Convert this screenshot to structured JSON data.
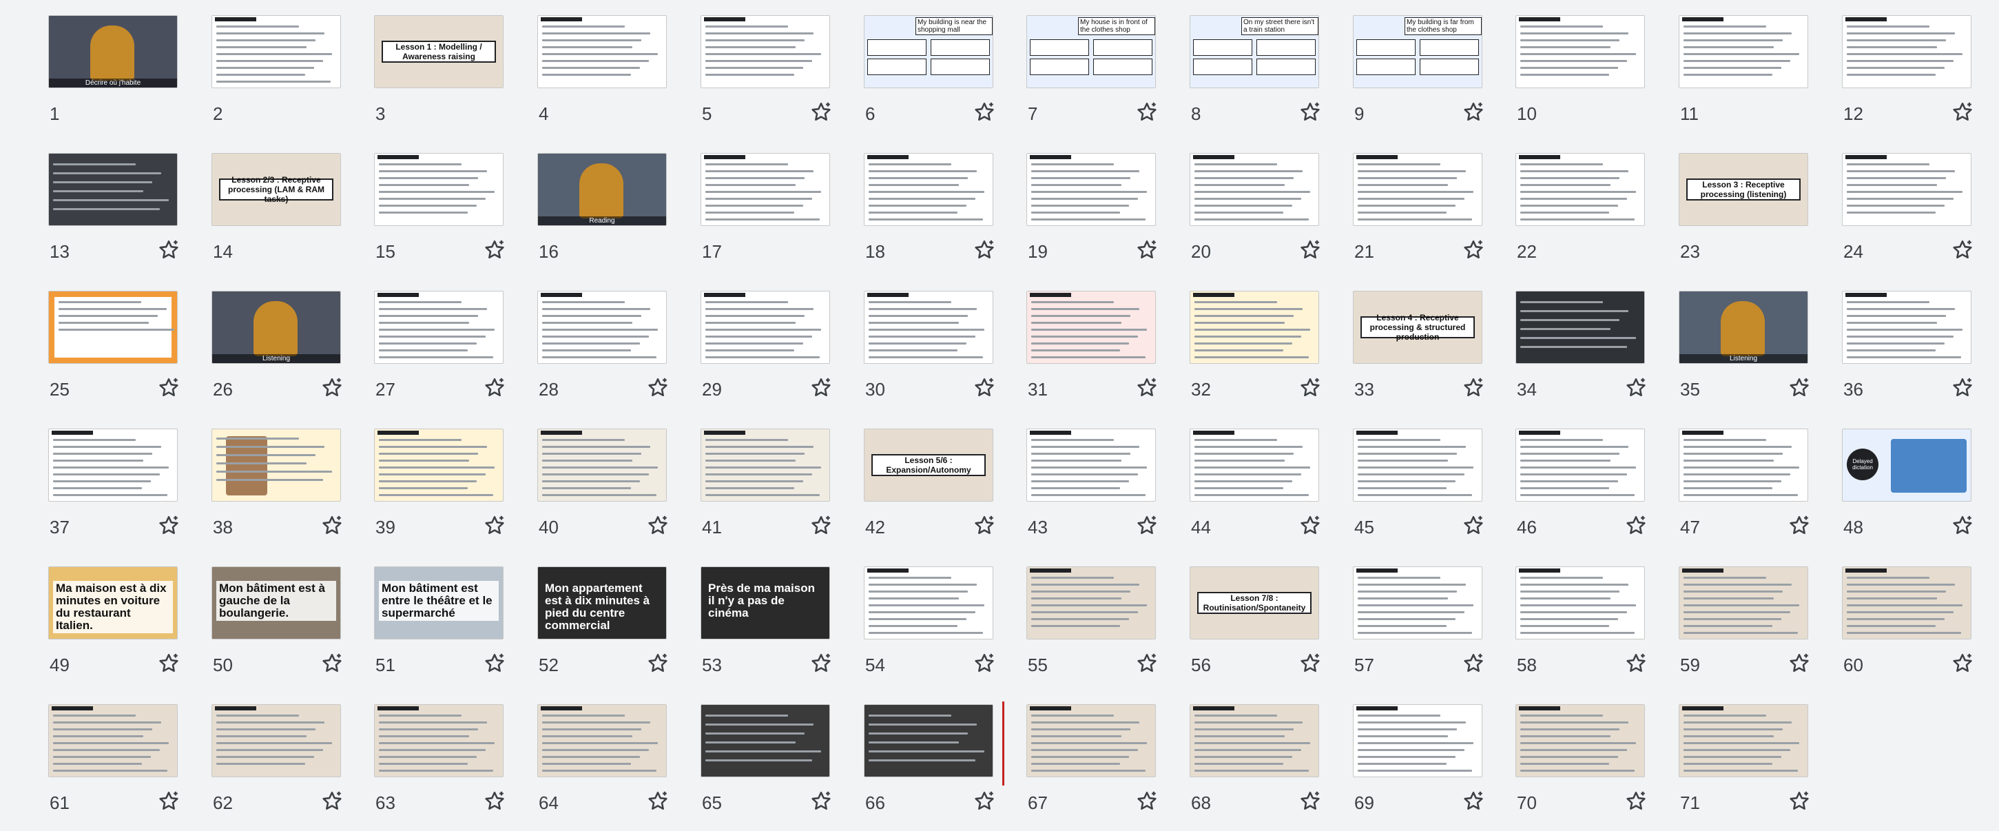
{
  "slides": [
    {
      "n": "1",
      "kind": "photo",
      "caption": "Décrire où j'habite",
      "bg": "#4a4f5e"
    },
    {
      "n": "2",
      "kind": "table",
      "bg": "#ffffff"
    },
    {
      "n": "3",
      "kind": "lesson",
      "text": "Lesson 1 : Modelling / Awareness raising",
      "bg": "#e6ddd0"
    },
    {
      "n": "4",
      "kind": "list",
      "bg": "#ffffff"
    },
    {
      "n": "5",
      "kind": "list",
      "bg": "#ffffff"
    },
    {
      "n": "6",
      "kind": "boxes",
      "text": "My building is near the shopping mall",
      "bg": "#e8f0fe"
    },
    {
      "n": "7",
      "kind": "boxes",
      "text": "My house is in front of the clothes shop",
      "bg": "#e8f0fe"
    },
    {
      "n": "8",
      "kind": "boxes",
      "text": "On my street there isn't a train station",
      "bg": "#e8f0fe"
    },
    {
      "n": "9",
      "kind": "boxes",
      "text": "My building is far from the clothes shop",
      "bg": "#e8f0fe"
    },
    {
      "n": "10",
      "kind": "list",
      "bg": "#ffffff"
    },
    {
      "n": "11",
      "kind": "list",
      "bg": "#ffffff"
    },
    {
      "n": "12",
      "kind": "list",
      "bg": "#ffffff"
    },
    {
      "n": "13",
      "kind": "dark",
      "bg": "#3b3f45"
    },
    {
      "n": "14",
      "kind": "lesson",
      "text": "Lesson 2/3 : Receptive processing (LAM & RAM tasks)",
      "bg": "#e6ddd0"
    },
    {
      "n": "15",
      "kind": "list",
      "bg": "#ffffff"
    },
    {
      "n": "16",
      "kind": "photo",
      "caption": "Reading",
      "bg": "#556070"
    },
    {
      "n": "17",
      "kind": "text",
      "bg": "#ffffff"
    },
    {
      "n": "18",
      "kind": "text",
      "bg": "#ffffff"
    },
    {
      "n": "19",
      "kind": "text",
      "bg": "#ffffff"
    },
    {
      "n": "20",
      "kind": "text",
      "bg": "#ffffff"
    },
    {
      "n": "21",
      "kind": "text",
      "bg": "#ffffff"
    },
    {
      "n": "22",
      "kind": "text",
      "bg": "#ffffff"
    },
    {
      "n": "23",
      "kind": "lesson",
      "text": "Lesson 3 : Receptive processing (listening)",
      "bg": "#e6ddd0"
    },
    {
      "n": "24",
      "kind": "list",
      "bg": "#ffffff"
    },
    {
      "n": "25",
      "kind": "orange",
      "bg": "#f29a38"
    },
    {
      "n": "26",
      "kind": "photo",
      "caption": "Listening",
      "bg": "#4d5360"
    },
    {
      "n": "27",
      "kind": "text",
      "bg": "#ffffff"
    },
    {
      "n": "28",
      "kind": "text",
      "bg": "#ffffff"
    },
    {
      "n": "29",
      "kind": "text",
      "bg": "#ffffff"
    },
    {
      "n": "30",
      "kind": "text",
      "bg": "#ffffff"
    },
    {
      "n": "31",
      "kind": "text",
      "bg": "#fce8e6"
    },
    {
      "n": "32",
      "kind": "text",
      "bg": "#fff4d6"
    },
    {
      "n": "33",
      "kind": "lesson",
      "text": "Lesson 4 : Receptive processing & structured production",
      "bg": "#e6ddd0"
    },
    {
      "n": "34",
      "kind": "dark",
      "bg": "#2f3237"
    },
    {
      "n": "35",
      "kind": "photo",
      "caption": "Listening",
      "bg": "#556070"
    },
    {
      "n": "36",
      "kind": "text",
      "bg": "#ffffff"
    },
    {
      "n": "37",
      "kind": "text",
      "bg": "#ffffff"
    },
    {
      "n": "38",
      "kind": "portrait",
      "bg": "#fff4d6"
    },
    {
      "n": "39",
      "kind": "text",
      "bg": "#fff4d6"
    },
    {
      "n": "40",
      "kind": "text",
      "bg": "#f1ece2"
    },
    {
      "n": "41",
      "kind": "text",
      "bg": "#f1ece2"
    },
    {
      "n": "42",
      "kind": "lesson",
      "text": "Lesson 5/6 : Expansion/Autonomy",
      "bg": "#e6ddd0"
    },
    {
      "n": "43",
      "kind": "text",
      "bg": "#ffffff"
    },
    {
      "n": "44",
      "kind": "text",
      "bg": "#ffffff"
    },
    {
      "n": "45",
      "kind": "text",
      "bg": "#ffffff"
    },
    {
      "n": "46",
      "kind": "text",
      "bg": "#ffffff"
    },
    {
      "n": "47",
      "kind": "text",
      "bg": "#ffffff"
    },
    {
      "n": "48",
      "kind": "timer",
      "bg": "#e8f0fe",
      "label": "Delayed dictation"
    },
    {
      "n": "49",
      "kind": "big",
      "text": "Ma maison est à dix minutes en voiture du restaurant Italien.",
      "bg": "#e8c070"
    },
    {
      "n": "50",
      "kind": "big",
      "text": "Mon bâtiment est à gauche de la boulangerie.",
      "bg": "#8a7d6e"
    },
    {
      "n": "51",
      "kind": "big",
      "text": "Mon bâtiment est entre le théâtre et le supermarché",
      "bg": "#b8c2cc"
    },
    {
      "n": "52",
      "kind": "bigdark",
      "text": "Mon appartement est à dix minutes à pied du centre commercial",
      "bg": "#2a2a2a"
    },
    {
      "n": "53",
      "kind": "bigdark",
      "text": "Près de ma maison il n'y a pas de cinéma",
      "bg": "#2a2a2a"
    },
    {
      "n": "54",
      "kind": "text",
      "bg": "#ffffff"
    },
    {
      "n": "55",
      "kind": "list",
      "bg": "#e6ddd0"
    },
    {
      "n": "56",
      "kind": "lesson",
      "text": "Lesson 7/8 : Routinisation/Spontaneity",
      "bg": "#e6ddd0"
    },
    {
      "n": "57",
      "kind": "text",
      "bg": "#ffffff"
    },
    {
      "n": "58",
      "kind": "text",
      "bg": "#ffffff"
    },
    {
      "n": "59",
      "kind": "text",
      "bg": "#e6ddd0"
    },
    {
      "n": "60",
      "kind": "text",
      "bg": "#e6ddd0"
    },
    {
      "n": "61",
      "kind": "text",
      "bg": "#e6ddd0"
    },
    {
      "n": "62",
      "kind": "list",
      "bg": "#e6ddd0"
    },
    {
      "n": "63",
      "kind": "text",
      "bg": "#e6ddd0"
    },
    {
      "n": "64",
      "kind": "text",
      "bg": "#e6ddd0"
    },
    {
      "n": "65",
      "kind": "dark",
      "bg": "#3a3a3a"
    },
    {
      "n": "66",
      "kind": "dark",
      "bg": "#3a3a3a"
    },
    {
      "n": "67",
      "kind": "text",
      "bg": "#e6ddd0"
    },
    {
      "n": "68",
      "kind": "text",
      "bg": "#e6ddd0"
    },
    {
      "n": "69",
      "kind": "text",
      "bg": "#ffffff"
    },
    {
      "n": "70",
      "kind": "text",
      "bg": "#e6ddd0"
    },
    {
      "n": "71",
      "kind": "text",
      "bg": "#e6ddd0"
    }
  ],
  "stars_on": [
    "5",
    "6",
    "7",
    "8",
    "9",
    "12",
    "13",
    "15",
    "18",
    "19",
    "20",
    "21",
    "24",
    "25",
    "26",
    "27",
    "28",
    "29",
    "30",
    "31",
    "32",
    "33",
    "34",
    "35",
    "36",
    "37",
    "38",
    "39",
    "40",
    "41",
    "42",
    "43",
    "44",
    "45",
    "46",
    "47",
    "48",
    "49",
    "50",
    "51",
    "52",
    "53",
    "54",
    "55",
    "56",
    "57",
    "58",
    "59",
    "60",
    "61",
    "62",
    "63",
    "64",
    "65",
    "66",
    "67",
    "68",
    "69",
    "70",
    "71"
  ],
  "icon": "star-icon"
}
